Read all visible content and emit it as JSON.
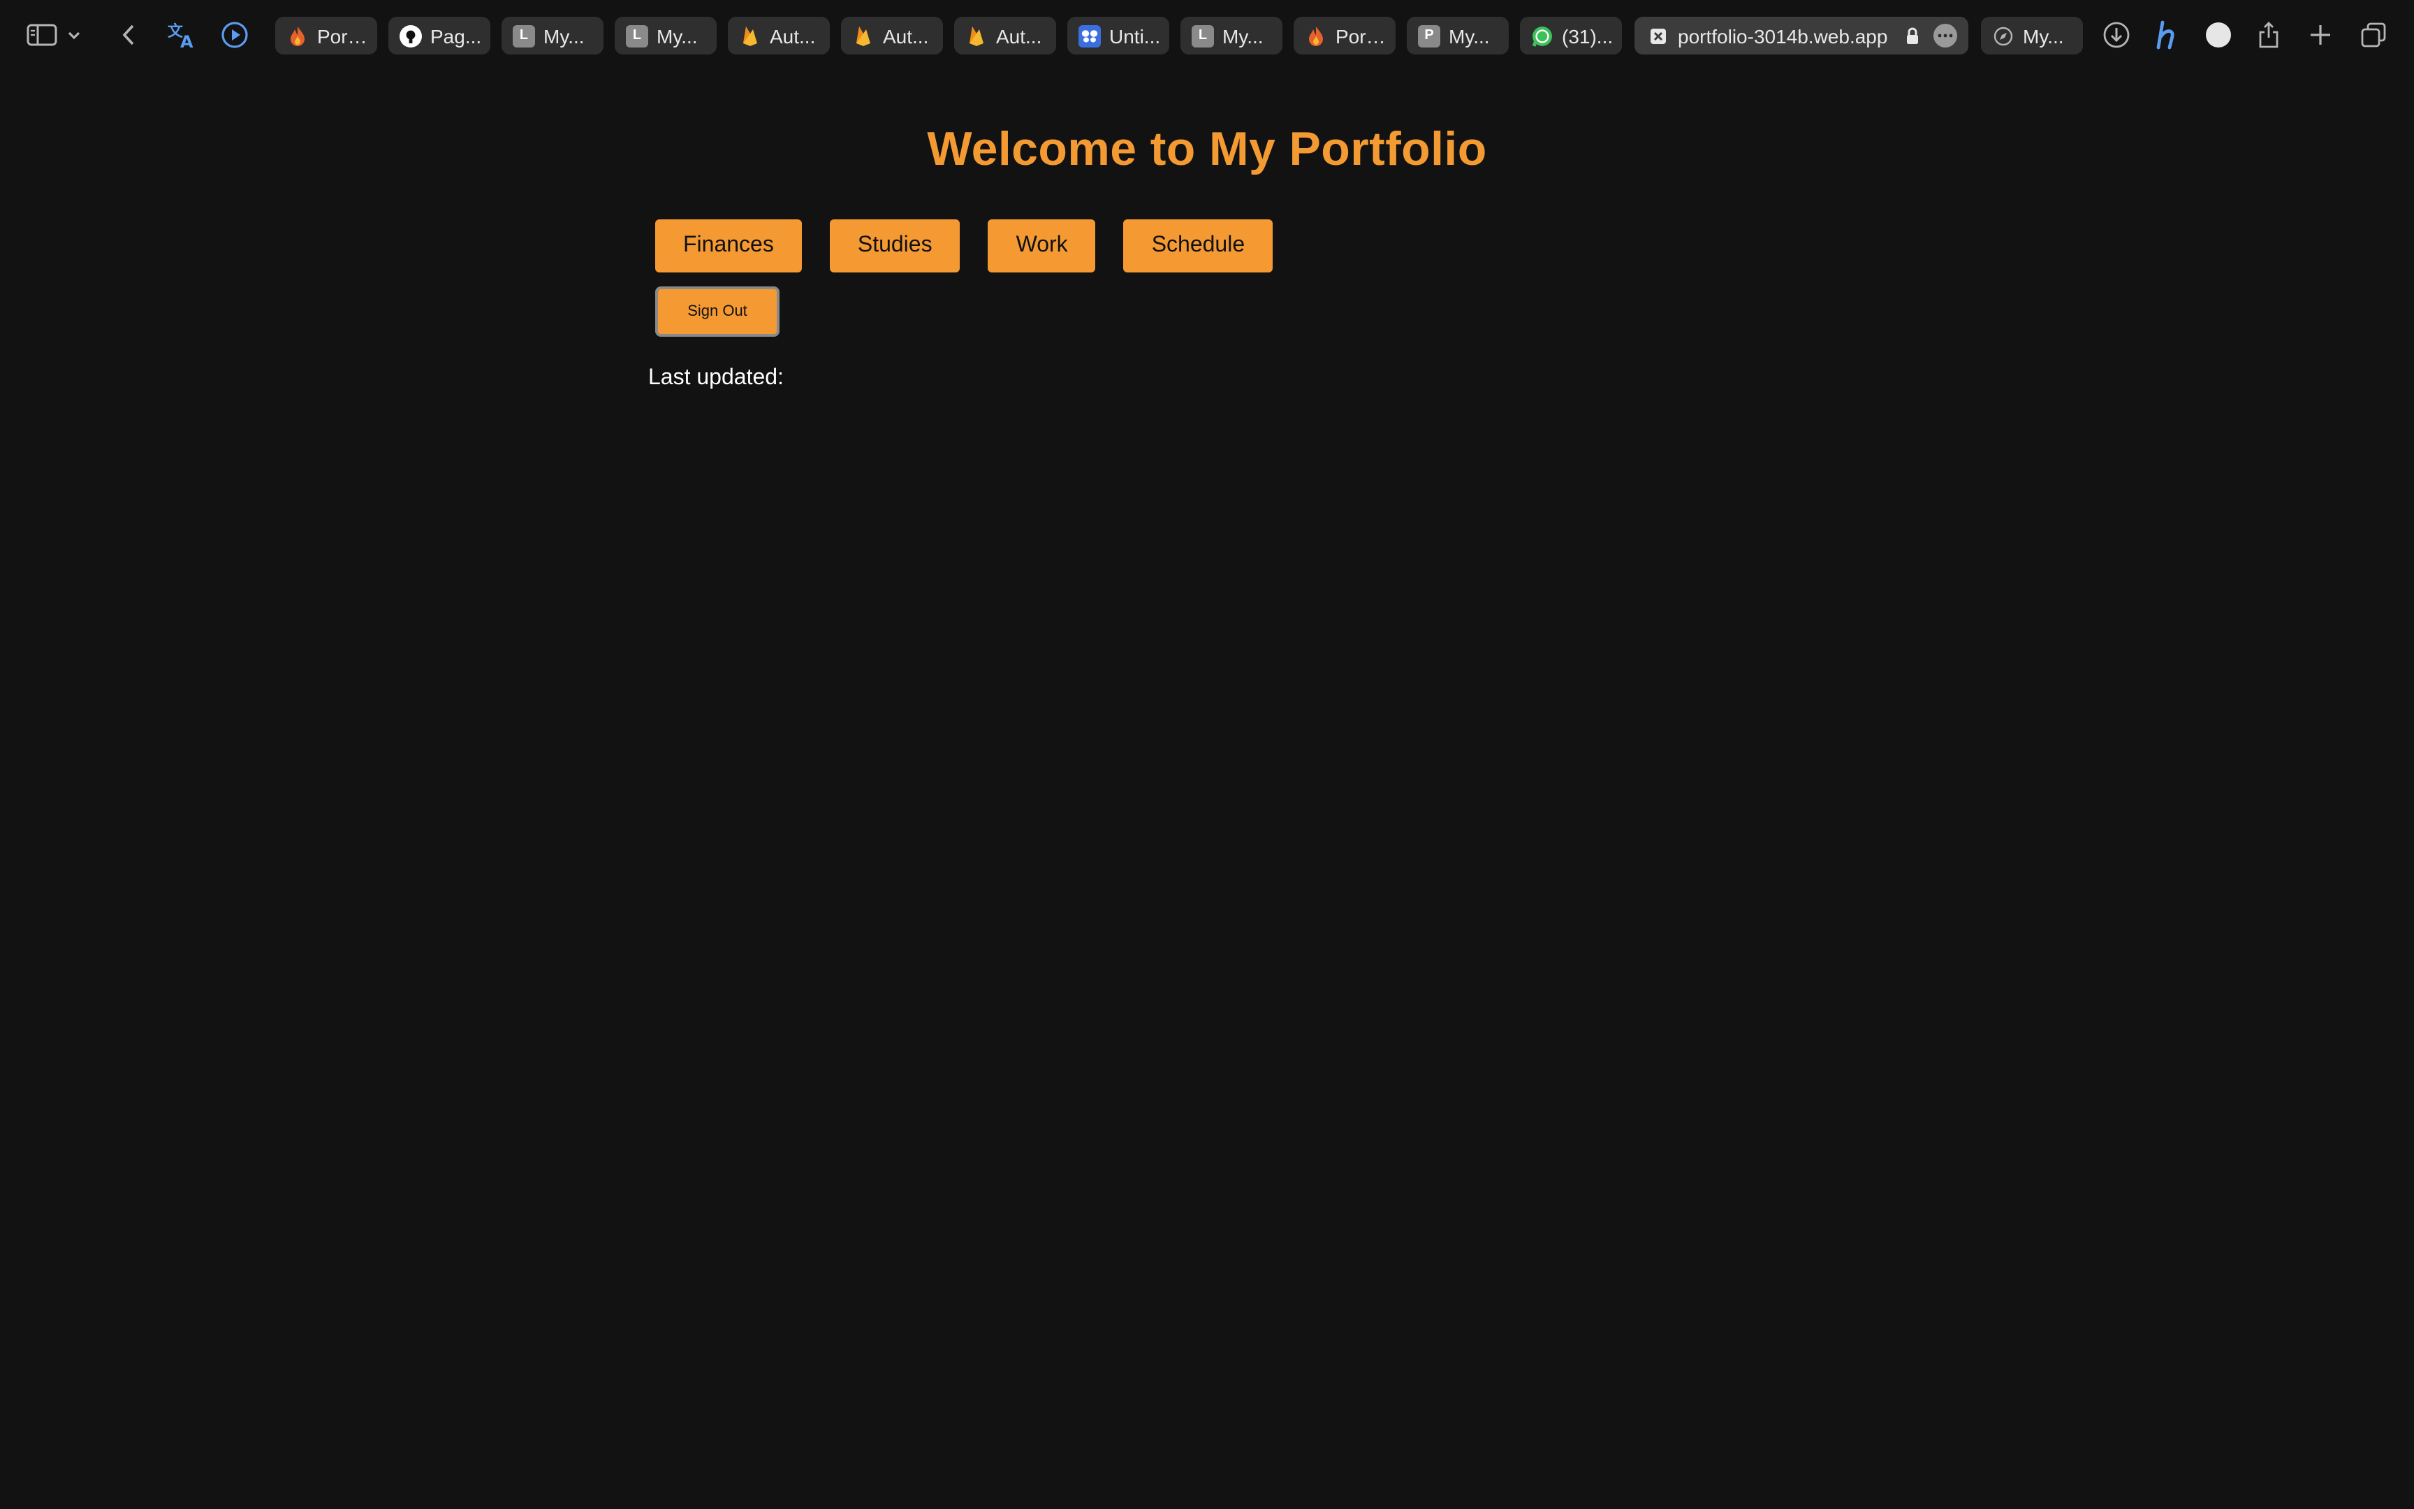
{
  "browser": {
    "tabs": [
      {
        "label": "Port...",
        "icon": "firebase-flame-icon",
        "color": "#e8612c"
      },
      {
        "label": "Pag...",
        "icon": "github-icon",
        "color": "#ffffff"
      },
      {
        "label": "My...",
        "icon": "letter-l-icon",
        "letter": "L",
        "color": "#8a8a8a"
      },
      {
        "label": "My...",
        "icon": "letter-l-icon",
        "letter": "L",
        "color": "#8a8a8a"
      },
      {
        "label": "Aut...",
        "icon": "firebase-icon",
        "color": "#f5b82e"
      },
      {
        "label": "Aut...",
        "icon": "firebase-icon",
        "color": "#f5b82e"
      },
      {
        "label": "Aut...",
        "icon": "firebase-icon",
        "color": "#f5b82e"
      },
      {
        "label": "Unti...",
        "icon": "butterfly-icon",
        "color": "#3b6fe0"
      },
      {
        "label": "My...",
        "icon": "letter-l-icon",
        "letter": "L",
        "color": "#8a8a8a"
      },
      {
        "label": "Port...",
        "icon": "firebase-flame-icon",
        "color": "#e8612c"
      },
      {
        "label": "My...",
        "icon": "letter-p-icon",
        "letter": "P",
        "color": "#8a8a8a"
      },
      {
        "label": "(31)...",
        "icon": "whatsapp-icon",
        "color": "#3ec05a"
      }
    ],
    "active_tab": {
      "url": "portfolio-3014b.web.app",
      "icon": "close-tab-icon"
    },
    "last_tab": {
      "label": "My...",
      "icon": "compass-icon"
    }
  },
  "page": {
    "title": "Welcome to My Portfolio",
    "nav_buttons": [
      "Finances",
      "Studies",
      "Work",
      "Schedule"
    ],
    "sign_out_label": "Sign Out",
    "last_updated_label": "Last updated:"
  },
  "colors": {
    "accent": "#f59a33",
    "background": "#121212"
  }
}
